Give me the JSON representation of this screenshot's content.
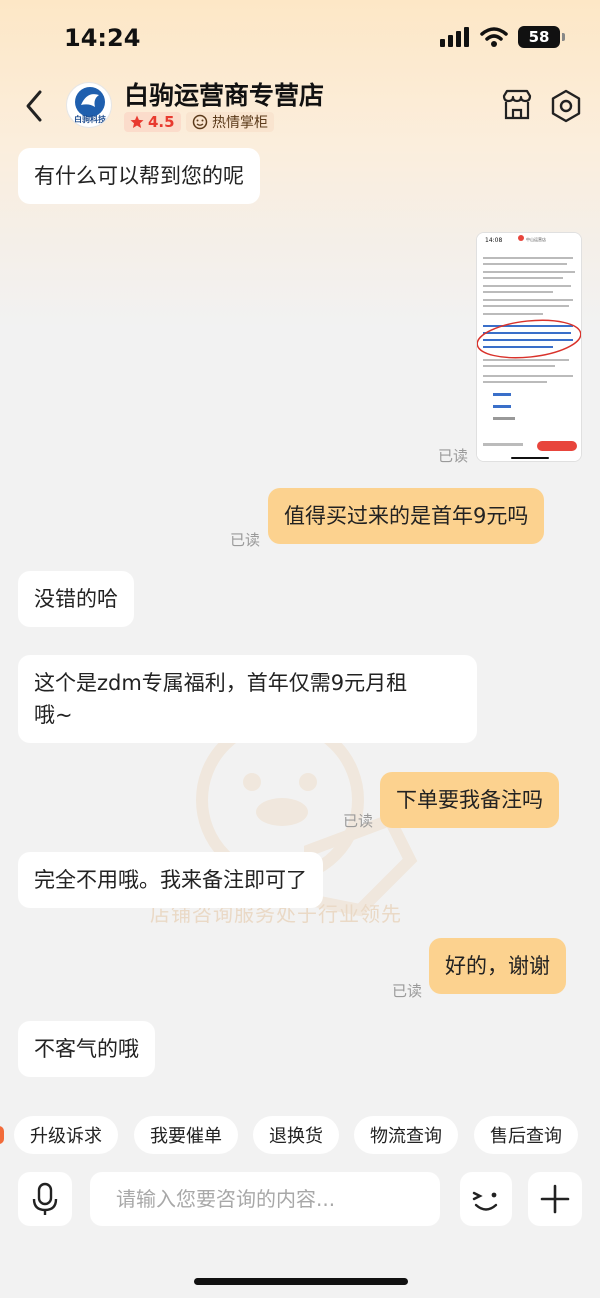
{
  "status": {
    "time": "14:24",
    "battery": "58"
  },
  "header": {
    "store_name": "白驹运营商专营店",
    "logo_text": "白驹科技",
    "rating": "4.5",
    "hot_label": "热情掌柜"
  },
  "messages": [
    {
      "side": "left",
      "text": "有什么可以帮到您的呢"
    },
    {
      "side": "right",
      "type": "image",
      "read": "已读"
    },
    {
      "side": "right",
      "text": "值得买过来的是首年9元吗",
      "read": "已读"
    },
    {
      "side": "left",
      "text": "没错的哈"
    },
    {
      "side": "left",
      "lines": [
        "这个是zdm专属福利，首年仅需9元月租",
        "哦~"
      ]
    },
    {
      "side": "right",
      "text": "下单要我备注吗",
      "read": "已读"
    },
    {
      "side": "left",
      "text": "完全不用哦。我来备注即可了"
    },
    {
      "side": "right",
      "text": "好的，谢谢",
      "read": "已读"
    },
    {
      "side": "left",
      "text": "不客气的哦"
    }
  ],
  "screenshot_preview": {
    "time": "14:08",
    "title": "中山运营店"
  },
  "watermark": "店铺咨询服务处于行业领先",
  "quick_replies": [
    "升级诉求",
    "我要催单",
    "退换货",
    "物流查询",
    "售后查询"
  ],
  "input": {
    "placeholder": "请输入您要咨询的内容..."
  },
  "colors": {
    "bubble_right": "#fcd28f",
    "bubble_left": "#ffffff",
    "rating": "#e83a2f"
  }
}
